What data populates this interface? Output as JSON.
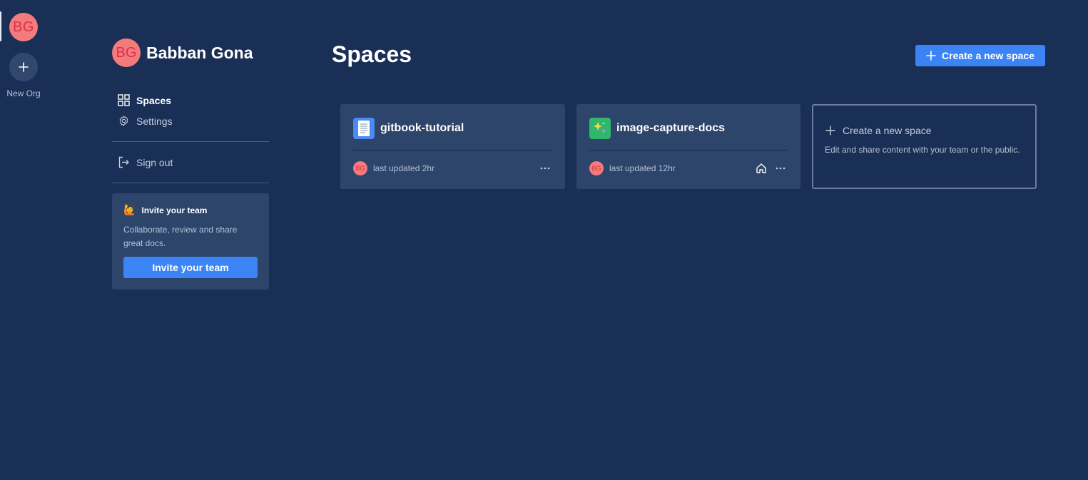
{
  "rail": {
    "org_initials": "BG",
    "new_org_label": "New Org",
    "new_org_icon": "plus-icon"
  },
  "sidebar": {
    "org_initials": "BG",
    "org_name": "Babban Gona",
    "nav": [
      {
        "label": "Spaces",
        "icon": "grid-icon",
        "active": true
      },
      {
        "label": "Settings",
        "icon": "gear-icon",
        "active": false
      }
    ],
    "sign_out": {
      "label": "Sign out",
      "icon": "sign-out-icon"
    },
    "invite": {
      "emoji": "🙋",
      "title": "Invite your team",
      "text": "Collaborate, review and share great docs.",
      "button": "Invite your team"
    }
  },
  "main": {
    "title": "Spaces",
    "create_button": "Create a new space",
    "spaces": [
      {
        "name": "gitbook-tutorial",
        "icon": "document-icon",
        "icon_color": "#4a8af4",
        "author_initials": "BG",
        "updated": "last updated 2hr",
        "is_home": false
      },
      {
        "name": "image-capture-docs",
        "icon": "sparkles-icon",
        "icon_color": "#2fb86c",
        "author_initials": "BG",
        "updated": "last updated 12hr",
        "is_home": true
      }
    ],
    "new_space_card": {
      "title": "Create a new space",
      "description": "Edit and share content with your team or the public."
    }
  },
  "colors": {
    "background": "#1a2f55",
    "card": "#2d446b",
    "accent": "#3a84f6",
    "avatar": "#f47b7b"
  }
}
